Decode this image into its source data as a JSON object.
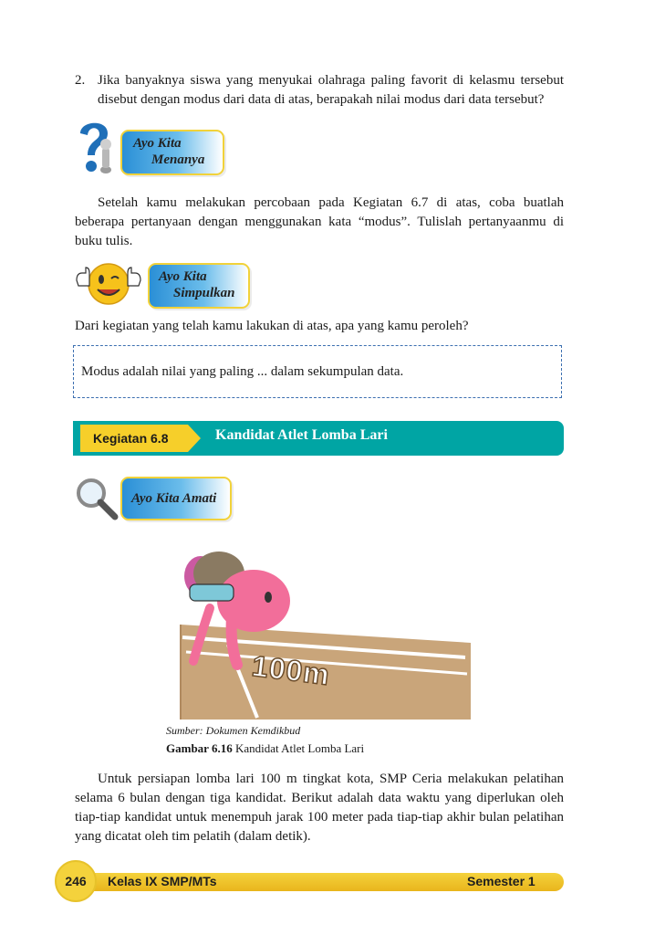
{
  "question": {
    "number": "2.",
    "text": "Jika banyaknya siswa yang menyukai olahraga paling favorit di kelasmu tersebut disebut dengan modus dari data di atas, berapakah nilai modus dari data tersebut?"
  },
  "menanya": {
    "line1": "Ayo Kita",
    "line2": "Menanya",
    "paragraph": "Setelah kamu melakukan percobaan pada Kegiatan 6.7 di atas, coba buatlah beberapa pertanyaan dengan menggunakan kata “modus”. Tulislah pertanyaanmu di buku tulis."
  },
  "simpulkan": {
    "line1": "Ayo Kita",
    "line2": "Simpulkan",
    "prompt": "Dari kegiatan yang telah kamu lakukan di atas, apa yang kamu peroleh?",
    "box_text": "Modus adalah nilai yang paling ...  dalam sekumpulan data."
  },
  "kegiatan": {
    "tag": "Kegiatan 6.8",
    "title": "Kandidat Atlet Lomba Lari"
  },
  "amati": {
    "label": "Ayo Kita Amati"
  },
  "figure": {
    "track_text": "100m",
    "source": "Sumber: Dokumen Kemdikbud",
    "caption_bold": "Gambar 6.16",
    "caption_text": " Kandidat Atlet Lomba Lari"
  },
  "closing_paragraph": "Untuk persiapan lomba lari 100 m tingkat kota, SMP Ceria melakukan pelatihan selama 6 bulan dengan tiga kandidat.  Berikut adalah data waktu yang diperlukan oleh tiap-tiap kandidat untuk menempuh jarak 100 meter pada tiap-tiap akhir bulan pelatihan yang dicatat oleh tim pelatih (dalam detik).",
  "footer": {
    "page_number": "246",
    "book": "Kelas IX SMP/MTs",
    "semester": "Semester 1"
  },
  "colors": {
    "teal": "#00a5a4",
    "yellow": "#f4d23c",
    "badge_blue": "#2a8fd6"
  }
}
